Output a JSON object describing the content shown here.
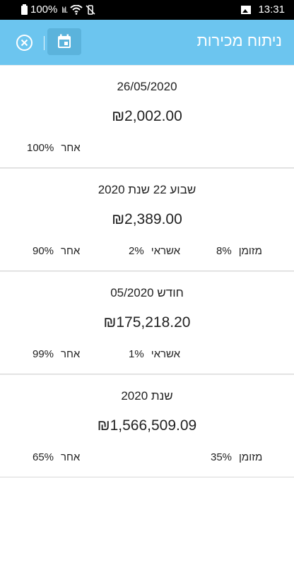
{
  "status_bar": {
    "battery": "100%",
    "time": "13:31",
    "signal_text": "lıl."
  },
  "app_bar": {
    "title": "ניתוח מכירות",
    "close_icon": "close-circle-icon",
    "calendar_icon": "calendar-icon"
  },
  "colors": {
    "app_bar": "#6cc5ef",
    "calendar_button": "#5bb3dc"
  },
  "cards": [
    {
      "title": "26/05/2020",
      "amount": "₪2,002.00",
      "metrics": [
        {
          "label": "אחר",
          "pct": "100%"
        }
      ]
    },
    {
      "title": "שבוע 22 שנת 2020",
      "amount": "₪2,389.00",
      "metrics": [
        {
          "label": "אחר",
          "pct": "90%"
        },
        {
          "label": "אשראי",
          "pct": "2%"
        },
        {
          "label": "מזומן",
          "pct": "8%"
        }
      ]
    },
    {
      "title": "חודש 05/2020",
      "amount": "₪175,218.20",
      "metrics": [
        {
          "label": "אחר",
          "pct": "99%"
        },
        {
          "label": "אשראי",
          "pct": "1%"
        }
      ]
    },
    {
      "title": "שנת 2020",
      "amount": "₪1,566,509.09",
      "metrics": [
        {
          "label": "אחר",
          "pct": "65%"
        },
        {
          "label": "מזומן",
          "pct": "35%"
        }
      ]
    }
  ]
}
